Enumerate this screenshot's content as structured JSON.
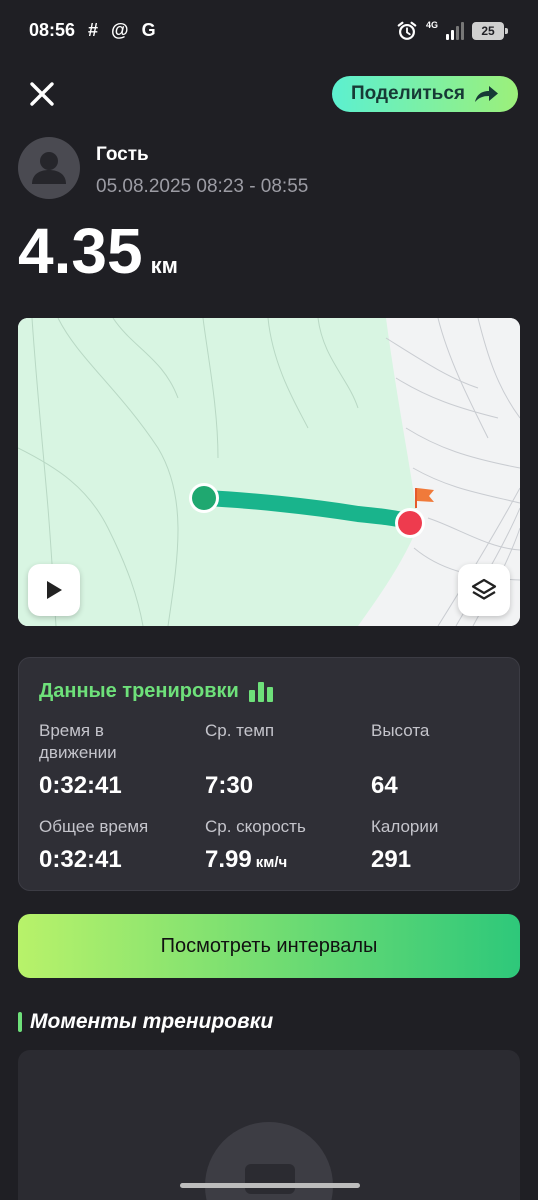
{
  "status_bar": {
    "time": "08:56",
    "left_icons": "# @ G",
    "network": "4G",
    "battery": "25"
  },
  "header": {
    "close_icon": "close-icon",
    "share_label": "Поделиться",
    "share_icon": "share-arrow-icon",
    "share_gradient": [
      "#5cf0d0",
      "#9cf07a"
    ]
  },
  "user": {
    "name": "Гость",
    "datetime": "05.08.2025 08:23 - 08:55"
  },
  "distance": {
    "value": "4.35",
    "unit": "км"
  },
  "map": {
    "route_color": "#19b48c",
    "start_color": "#1fa870",
    "finish_color": "#ee3b4e",
    "play_icon": "play-icon",
    "layers_icon": "layers-icon"
  },
  "stats": {
    "title": "Данные тренировки",
    "title_color": "#6ee07a",
    "items": [
      {
        "label": "Время в движении",
        "value": "0:32:41",
        "unit": ""
      },
      {
        "label": "Ср. темп",
        "value": "7:30",
        "unit": ""
      },
      {
        "label": "Высота",
        "value": "64",
        "unit": ""
      },
      {
        "label": "Общее время",
        "value": "0:32:41",
        "unit": ""
      },
      {
        "label": "Ср. скорость",
        "value": "7.99",
        "unit": "км/ч"
      },
      {
        "label": "Калории",
        "value": "291",
        "unit": ""
      }
    ]
  },
  "intervals_button": {
    "label": "Посмотреть интервалы",
    "gradient": [
      "#b8f26a",
      "#2ec87a"
    ]
  },
  "moments": {
    "title": "Моменты тренировки"
  }
}
